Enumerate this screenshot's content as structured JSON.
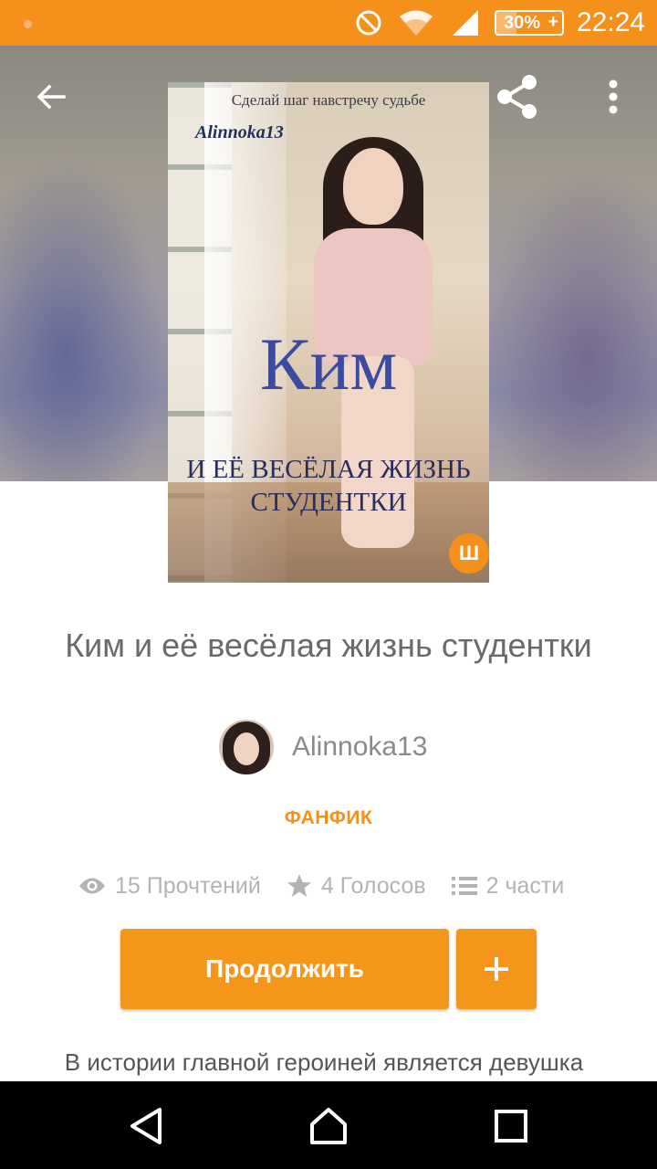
{
  "status_bar": {
    "battery": "30%",
    "battery_level": 0.3,
    "time": "22:24",
    "icons": [
      "notification-dot-icon",
      "do-not-disturb-icon",
      "wifi-icon",
      "cellular-signal-icon",
      "battery-charging-icon"
    ]
  },
  "toolbar": {
    "icons": [
      "back-arrow-icon",
      "share-icon",
      "more-vert-icon"
    ]
  },
  "cover": {
    "tagline": "Сделай шаг навстречу судьбе",
    "author": "Alinnoka13",
    "title": "Ким",
    "subtitle_line1": "И ЕЁ ВЕСЁЛАЯ ЖИЗНЬ",
    "subtitle_line2": "СТУДЕНТКИ",
    "badge": "Ш"
  },
  "story": {
    "title": "Ким и её весёлая жизнь студентки",
    "author": "Alinnoka13",
    "category": "ФАНФИК",
    "reads": "15 Прочтений",
    "votes": "4 Голосов",
    "parts": "2 части",
    "description": "В истории главной героиней является девушка"
  },
  "actions": {
    "continue_label": "Продолжить",
    "add_icon": "plus-icon"
  },
  "colors": {
    "accent": "#f5901b",
    "button": "#f5961b",
    "stats_text": "#b3b3b3",
    "title_text": "#6a6a6a"
  },
  "nav_bar": {
    "icons": [
      "nav-back-icon",
      "nav-home-icon",
      "nav-recents-icon"
    ]
  }
}
